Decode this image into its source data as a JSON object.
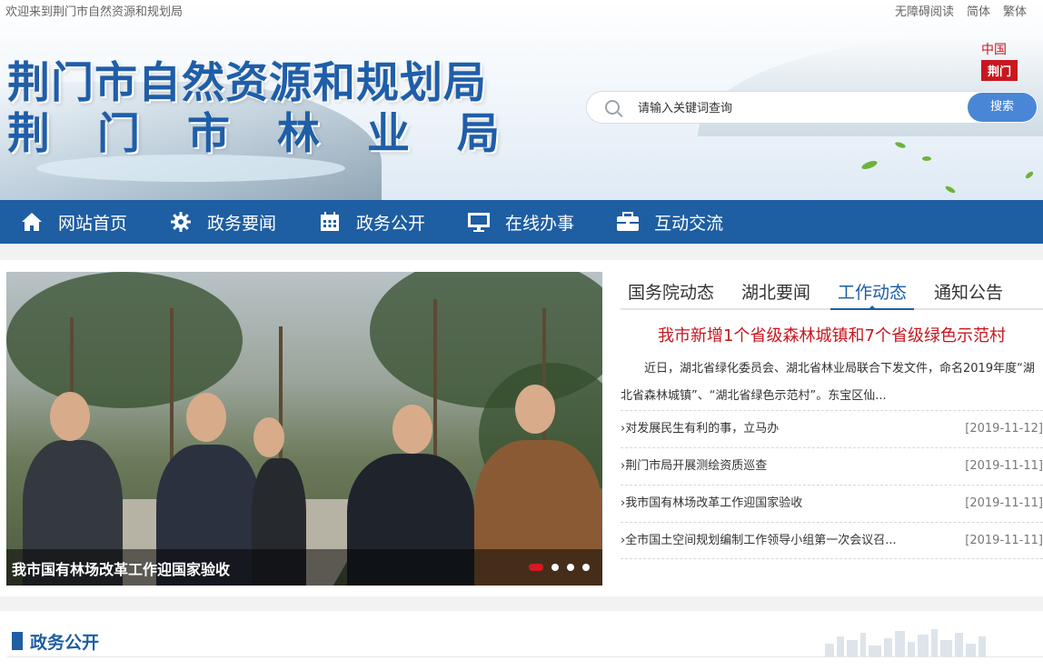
{
  "topbar": {
    "welcome": "欢迎来到荆门市自然资源和规划局",
    "links": [
      "无障碍阅读",
      "简体",
      "繁体"
    ]
  },
  "header": {
    "title_line1": "荆门市自然资源和规划局",
    "title_line2": "荆门市林业局",
    "logo_top": "中国",
    "logo_box": "荆门",
    "search": {
      "placeholder": "请输入关键词查询",
      "button": "搜索"
    }
  },
  "nav": {
    "items": [
      {
        "label": "网站首页",
        "icon": "home-icon"
      },
      {
        "label": "政务要闻",
        "icon": "gear-icon"
      },
      {
        "label": "政务公开",
        "icon": "calendar-icon"
      },
      {
        "label": "在线办事",
        "icon": "monitor-icon"
      },
      {
        "label": "互动交流",
        "icon": "briefcase-icon"
      }
    ]
  },
  "slider": {
    "caption": "我市国有林场改革工作迎国家验收",
    "dots": 4,
    "active_dot": 1
  },
  "news": {
    "tabs": [
      "国务院动态",
      "湖北要闻",
      "工作动态",
      "通知公告"
    ],
    "active_tab": 2,
    "headline": "我市新增1个省级森林城镇和7个省级绿色示范村",
    "summary": "近日，湖北省绿化委员会、湖北省林业局联合下发文件，命名2019年度“湖北省森林城镇”、“湖北省绿色示范村”。东宝区仙...",
    "items": [
      {
        "title": "对发展民生有利的事，立马办",
        "date": "[2019-11-12]"
      },
      {
        "title": "荆门市局开展测绘资质巡查",
        "date": "[2019-11-11]"
      },
      {
        "title": "我市国有林场改革工作迎国家验收",
        "date": "[2019-11-11]"
      },
      {
        "title": "全市国土空间规划编制工作领导小组第一次会议召...",
        "date": "[2019-11-11]"
      }
    ]
  },
  "section": {
    "title": "政务公开"
  },
  "colors": {
    "primary": "#1e5ea2",
    "accent_red": "#c9161f",
    "search_button": "#4a86d6"
  }
}
